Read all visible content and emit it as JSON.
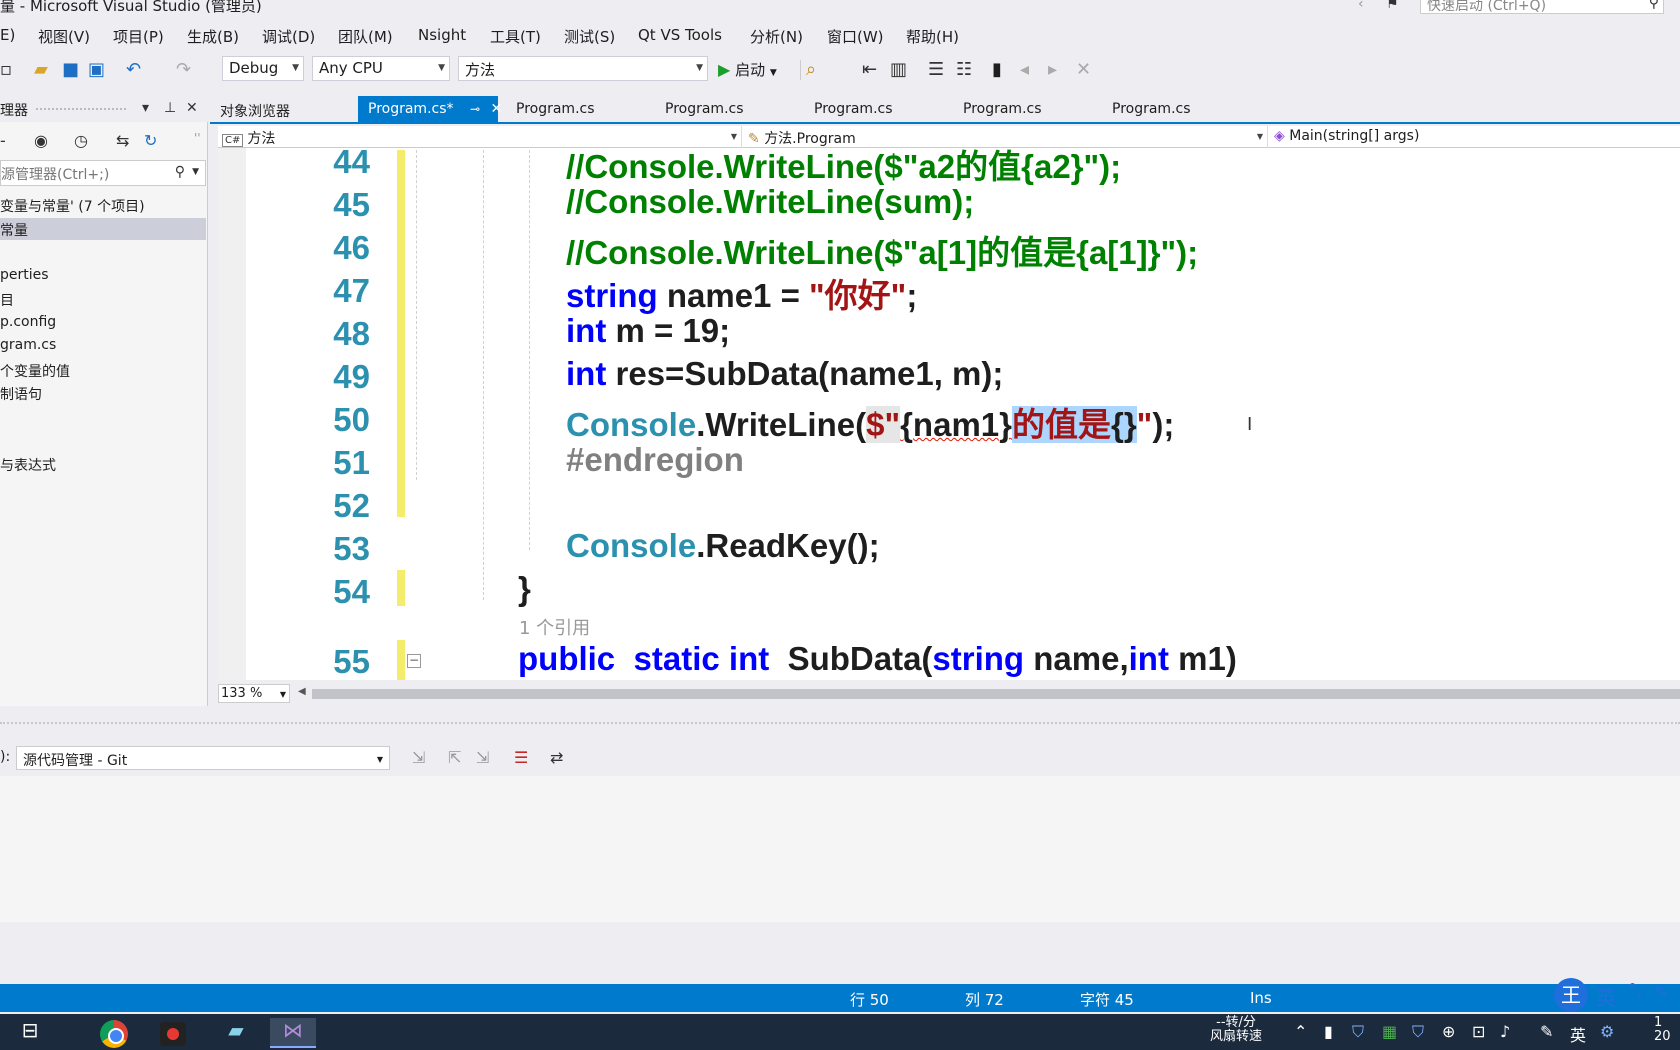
{
  "window": {
    "title": "量 - Microsoft Visual Studio (管理员)",
    "quick_launch_placeholder": "快速启动 (Ctrl+Q)"
  },
  "menu": [
    "E)",
    "视图(V)",
    "项目(P)",
    "生成(B)",
    "调试(D)",
    "团队(M)",
    "Nsight",
    "工具(T)",
    "测试(S)",
    "Qt VS Tools",
    "分析(N)",
    "窗口(W)",
    "帮助(H)"
  ],
  "toolbar": {
    "config": "Debug",
    "platform": "Any CPU",
    "project": "方法",
    "start_label": "启动"
  },
  "solution_explorer": {
    "title": "理器",
    "search_placeholder": "源管理器(Ctrl+;)",
    "items": [
      {
        "label": "变量与常量' (7 个项目)",
        "selected": false
      },
      {
        "label": "常量",
        "selected": true
      },
      {
        "label": "",
        "selected": false
      },
      {
        "label": "perties",
        "selected": false
      },
      {
        "label": "目",
        "selected": false
      },
      {
        "label": "p.config",
        "selected": false
      },
      {
        "label": "gram.cs",
        "selected": false
      },
      {
        "label": "个变量的值",
        "selected": false
      },
      {
        "label": "制语句",
        "selected": false
      },
      {
        "label": "",
        "selected": false
      },
      {
        "label": "",
        "selected": false
      },
      {
        "label": "与表达式",
        "selected": false
      }
    ]
  },
  "doc_tabs": [
    {
      "label": "对象浏览器",
      "active": false
    },
    {
      "label": "Program.cs*",
      "active": true
    },
    {
      "label": "Program.cs",
      "active": false
    },
    {
      "label": "Program.cs",
      "active": false
    },
    {
      "label": "Program.cs",
      "active": false
    },
    {
      "label": "Program.cs",
      "active": false
    },
    {
      "label": "Program.cs",
      "active": false
    }
  ],
  "nav_bar": {
    "project": "方法",
    "project_badge": "C#",
    "class": "方法.Program",
    "member": "Main(string[] args)"
  },
  "editor": {
    "line_numbers": [
      "44",
      "45",
      "46",
      "47",
      "48",
      "49",
      "50",
      "51",
      "52",
      "53",
      "54",
      "55"
    ],
    "codelens": "1 个引用",
    "zoom": "133 %"
  },
  "output": {
    "source_label": "):",
    "source_value": "源代码管理 - Git"
  },
  "status_bar": {
    "line": "行 50",
    "col": "列 72",
    "char": "字符 45",
    "mode": "Ins"
  },
  "ime": {
    "badge": "王",
    "lang": "英"
  },
  "taskbar": {
    "net_speed_top": "--转/分",
    "net_speed_bottom": "风扇转速",
    "tray_lang": "英",
    "clock_top": "1",
    "clock_bottom": "20"
  },
  "colors": {
    "accent": "#007acc",
    "keyword": "#0000ff",
    "string": "#a31515",
    "comment": "#008000",
    "type": "#2b91af",
    "line_number": "#2b91af"
  }
}
